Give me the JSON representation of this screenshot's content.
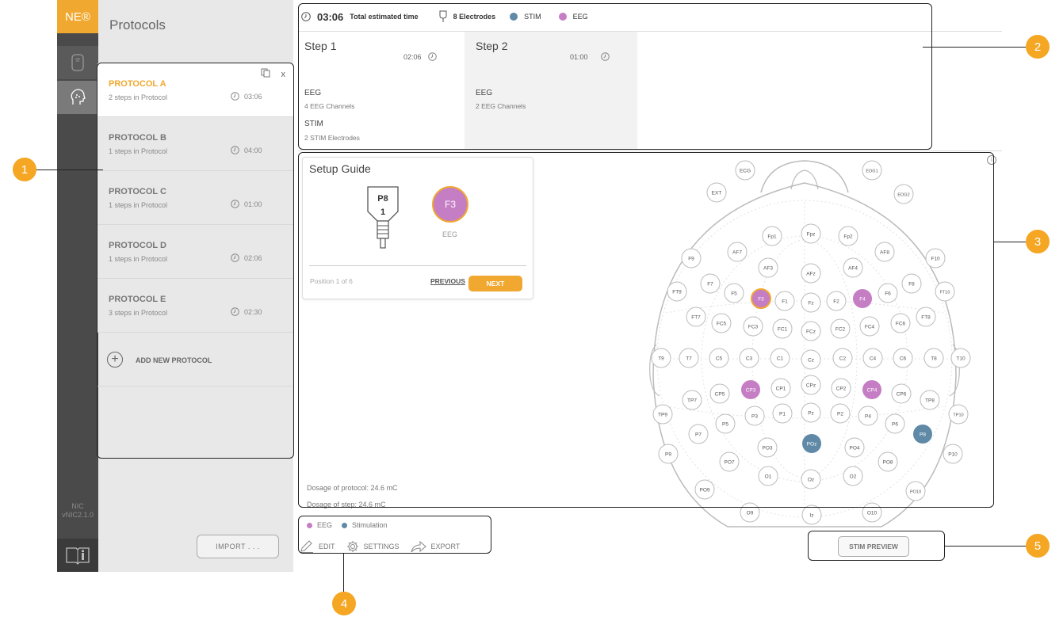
{
  "rail": {
    "logo": "NE®",
    "version_line1": "NIC",
    "version_line2": "vNIC2.1.0"
  },
  "sidebar": {
    "title": "Protocols",
    "protocols": [
      {
        "name": "PROTOCOL A",
        "steps": "2 steps in Protocol",
        "time": "03:06"
      },
      {
        "name": "PROTOCOL B",
        "steps": "1 steps in Protocol",
        "time": "04:00"
      },
      {
        "name": "PROTOCOL C",
        "steps": "1 steps in Protocol",
        "time": "01:00"
      },
      {
        "name": "PROTOCOL D",
        "steps": "1 steps in Protocol",
        "time": "02:06"
      },
      {
        "name": "PROTOCOL E",
        "steps": "3 steps in Protocol",
        "time": "02:30"
      }
    ],
    "close_label": "x",
    "add_new_label": "ADD NEW PROTOCOL",
    "import_label": "IMPORT . . ."
  },
  "topbar": {
    "total_time": "03:06",
    "total_time_label": "Total estimated time",
    "electrodes": "8 Electrodes",
    "stim_label": "STIM",
    "eeg_label": "EEG"
  },
  "steps": [
    {
      "title": "Step 1",
      "time": "02:06",
      "eeg": "EEG",
      "eeg_sub": "4 EEG Channels",
      "stim": "STIM",
      "stim_sub": "2 STIM Electrodes"
    },
    {
      "title": "Step 2",
      "time": "01:00",
      "eeg": "EEG",
      "eeg_sub": "2 EEG Channels"
    }
  ],
  "guide": {
    "title": "Setup Guide",
    "cable_label": "P8",
    "cable_number": "1",
    "electrode": "F3",
    "electrode_type": "EEG",
    "position": "Position 1 of 6",
    "previous": "PREVIOUS",
    "next": "NEXT"
  },
  "dosage": {
    "protocol": "Dosage of protocol: 24.6 mC",
    "step": "Dosage of step: 24.6 mC"
  },
  "legend": {
    "eeg": "EEG",
    "stim": "Stimulation"
  },
  "actions": {
    "edit": "EDIT",
    "settings": "SETTINGS",
    "export": "EXPORT"
  },
  "stim_preview": "STIM PREVIEW",
  "callouts": [
    "1",
    "2",
    "3",
    "4",
    "5"
  ],
  "colors": {
    "accent": "#f0a830",
    "eeg": "#c57dc4",
    "stim": "#5f89a6",
    "callout": "#f5a623"
  },
  "electrodes": {
    "labels": [
      "ECG",
      "EOG1",
      "EXT",
      "EOG2",
      "Fp1",
      "Fpz",
      "Fp2",
      "F9",
      "AF7",
      "AF8",
      "F10",
      "AF3",
      "AF4",
      "AFz",
      "FT9",
      "F7",
      "F5",
      "F3",
      "F1",
      "Fz",
      "F2",
      "F4",
      "F6",
      "F8",
      "FT10",
      "FT7",
      "FC5",
      "FC3",
      "FC1",
      "FCz",
      "FC2",
      "FC4",
      "FC6",
      "FT8",
      "T9",
      "T7",
      "C5",
      "C3",
      "C1",
      "Cz",
      "C2",
      "C4",
      "C6",
      "T8",
      "T10",
      "TP7",
      "CP5",
      "CP3",
      "CP1",
      "CPz",
      "CP2",
      "CP4",
      "CP6",
      "TP8",
      "TP9",
      "P7",
      "P5",
      "P3",
      "P1",
      "Pz",
      "P2",
      "P4",
      "P6",
      "TP10",
      "P9",
      "PO3",
      "POz",
      "PO4",
      "P8",
      "P10",
      "PO7",
      "PO8",
      "O1",
      "Oz",
      "O2",
      "PO9",
      "PO10",
      "O9",
      "Iz",
      "O10"
    ],
    "eeg_active": [
      "F3",
      "F4",
      "CP3",
      "CP4"
    ],
    "stim_active": [
      "POz",
      "P8"
    ],
    "current": "F3"
  }
}
